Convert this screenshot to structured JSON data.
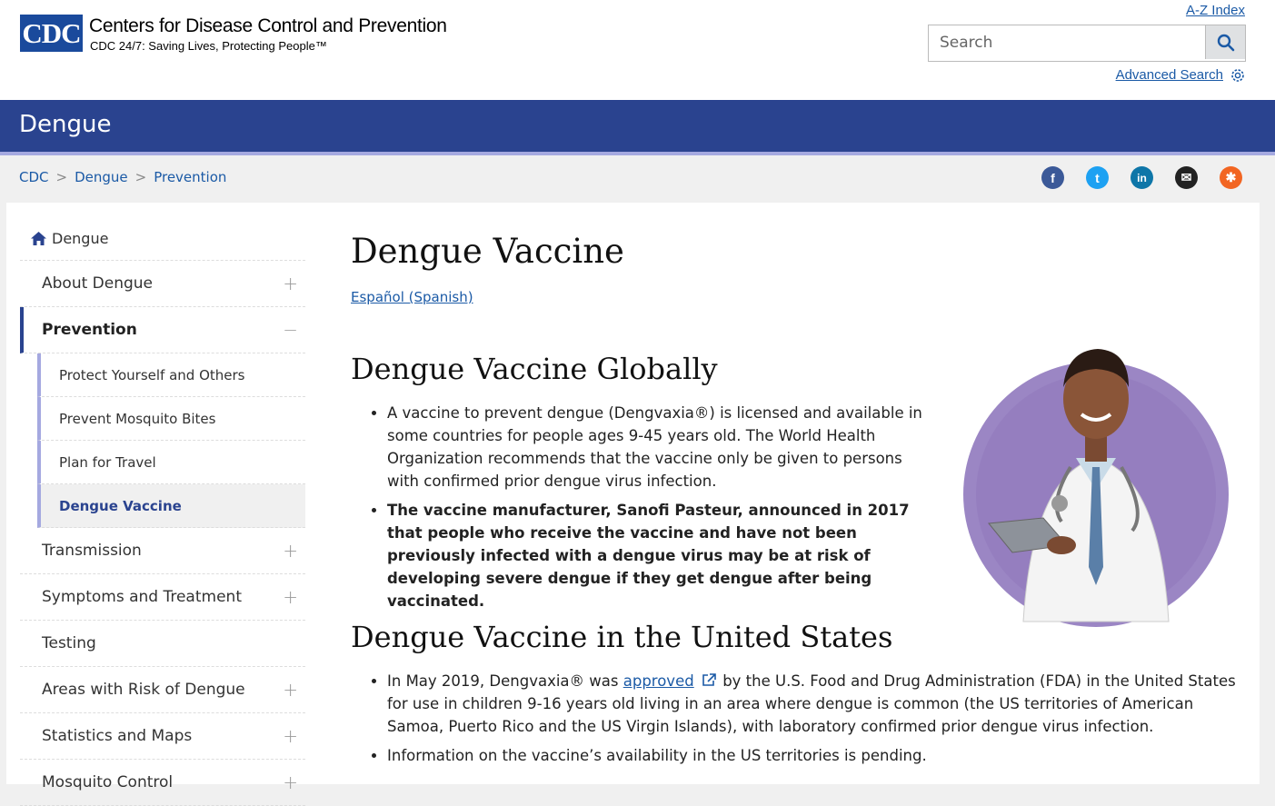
{
  "header": {
    "logo_text": "CDC",
    "site_name": "Centers for Disease Control and Prevention",
    "tagline": "CDC 24/7: Saving Lives, Protecting People™",
    "az_index": "A-Z Index",
    "search_placeholder": "Search",
    "advanced_search": "Advanced Search"
  },
  "title_bar": {
    "title": "Dengue"
  },
  "breadcrumb": [
    "CDC",
    "Dengue",
    "Prevention"
  ],
  "social": [
    {
      "name": "facebook",
      "color": "#3b5998",
      "glyph": "f"
    },
    {
      "name": "twitter",
      "color": "#1da1f2",
      "glyph": "t"
    },
    {
      "name": "linkedin",
      "color": "#0e76a8",
      "glyph": "in"
    },
    {
      "name": "email",
      "color": "#222222",
      "glyph": "✉"
    },
    {
      "name": "syndicate",
      "color": "#f26522",
      "glyph": "✱"
    }
  ],
  "sidebar": {
    "home": "Dengue",
    "items": [
      {
        "label": "About Dengue",
        "toggle": "+"
      },
      {
        "label": "Prevention",
        "toggle": "−"
      },
      {
        "label": "Transmission",
        "toggle": "+"
      },
      {
        "label": "Symptoms and Treatment",
        "toggle": "+"
      },
      {
        "label": "Testing",
        "toggle": ""
      },
      {
        "label": "Areas with Risk of Dengue",
        "toggle": "+"
      },
      {
        "label": "Statistics and Maps",
        "toggle": "+"
      },
      {
        "label": "Mosquito Control",
        "toggle": "+"
      }
    ],
    "sub_items": [
      "Protect Yourself and Others",
      "Prevent Mosquito Bites",
      "Plan for Travel",
      "Dengue Vaccine"
    ]
  },
  "content": {
    "title": "Dengue Vaccine",
    "spanish_link": "Español (Spanish)",
    "section1_heading": "Dengue Vaccine Globally",
    "section1_bullets": [
      "A vaccine to prevent dengue (Dengvaxia®) is licensed and available in some countries for people ages 9-45 years old. The World Health Organization recommends that the vaccine only be given to persons with confirmed prior dengue virus infection.",
      "The vaccine manufacturer, Sanofi Pasteur, announced in 2017 that people who receive the vaccine and have not been previously infected with a dengue virus may be at risk of developing severe dengue if they get dengue after being vaccinated."
    ],
    "section2_heading": "Dengue Vaccine in the United States",
    "section2_b1_pre": "In May 2019, Dengvaxia® was ",
    "section2_b1_link": "approved",
    "section2_b1_post": " by the U.S. Food and Drug Administration (FDA) in the United States for use in children 9-16 years old living in an area where dengue is common (the US territories of American Samoa, Puerto Rico and the US Virgin Islands), with laboratory confirmed prior dengue virus infection.",
    "section2_b2": "Information on the vaccine’s availability in the US territories is pending."
  }
}
